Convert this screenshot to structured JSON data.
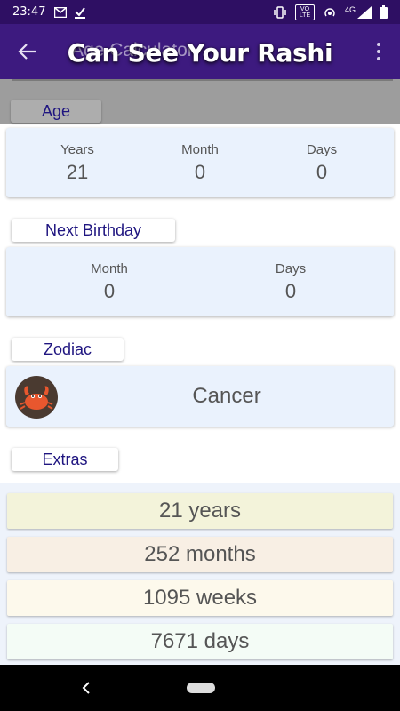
{
  "status_bar": {
    "time": "23:47",
    "network": "4G",
    "volte": "VO LTE"
  },
  "app_bar": {
    "title": "Age Calculator"
  },
  "banner": {
    "text": "Can See Your Rashi"
  },
  "age": {
    "label": "Age",
    "columns": [
      {
        "label": "Years",
        "value": "21"
      },
      {
        "label": "Month",
        "value": "0"
      },
      {
        "label": "Days",
        "value": "0"
      }
    ]
  },
  "next_birthday": {
    "label": "Next Birthday",
    "columns": [
      {
        "label": "Month",
        "value": "0"
      },
      {
        "label": "Days",
        "value": "0"
      }
    ]
  },
  "zodiac": {
    "label": "Zodiac",
    "sign": "Cancer",
    "icon": "crab-icon"
  },
  "extras": {
    "label": "Extras",
    "items": [
      {
        "text": "21 years",
        "color": "#f3f3da"
      },
      {
        "text": "252 months",
        "color": "#f8efe4"
      },
      {
        "text": "1095 weeks",
        "color": "#fdf9ec"
      },
      {
        "text": "7671 days",
        "color": "#f4fcf6"
      }
    ]
  },
  "colors": {
    "status_bar": "#2e0f63",
    "app_bar": "#3d1a7f",
    "card": "#eaf2fd",
    "label_text": "#1f1580"
  }
}
